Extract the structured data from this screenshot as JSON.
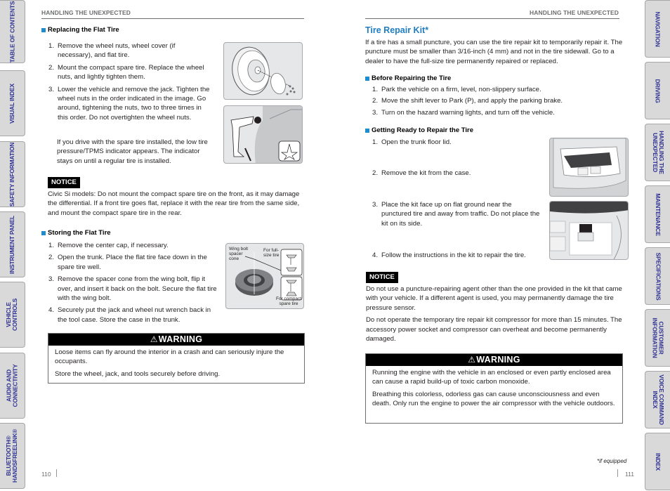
{
  "left_tabs": [
    {
      "label": "TABLE OF CONTENTS"
    },
    {
      "label": "VISUAL INDEX"
    },
    {
      "label": "SAFETY INFORMATION"
    },
    {
      "label": "INSTRUMENT PANEL"
    },
    {
      "label": "VEHICLE\nCONTROLS"
    },
    {
      "label": "AUDIO AND\nCONNECTIVITY"
    },
    {
      "label": "BLUETOOTH®\nHANDSFREELINK®"
    }
  ],
  "right_tabs": [
    {
      "label": "NAVIGATION"
    },
    {
      "label": "DRIVING"
    },
    {
      "label": "HANDLING THE\nUNEXPECTED"
    },
    {
      "label": "MAINTENANCE"
    },
    {
      "label": "SPECIFICATIONS"
    },
    {
      "label": "CUSTOMER\nINFORMATION"
    },
    {
      "label": "VOICE COMMAND\nINDEX"
    },
    {
      "label": "INDEX"
    }
  ],
  "left_page": {
    "running_head": "HANDLING THE UNEXPECTED",
    "page_number": "110",
    "replacing": {
      "heading": "Replacing the Flat Tire",
      "steps": [
        {
          "n": "1.",
          "text": "Remove the wheel nuts, wheel cover (if necessary), and flat tire."
        },
        {
          "n": "2.",
          "text": "Mount the compact spare tire. Replace the wheel nuts, and lightly tighten them."
        },
        {
          "n": "3.",
          "text": "Lower the vehicle and remove the jack. Tighten the wheel nuts in the order indicated in the image. Go around, tightening the nuts, two to three times in this order. Do not overtighten the wheel nuts."
        }
      ],
      "note": "If you drive with the spare tire installed, the low tire pressure/TPMS indicator appears. The indicator stays on until a regular tire is installed."
    },
    "notice": {
      "label": "NOTICE",
      "text": "Civic Si models: Do not mount the compact spare tire on the front, as it may damage the differential. If a front tire goes flat, replace it with the rear tire from the same side, and mount the compact spare tire in the rear."
    },
    "storing": {
      "heading": "Storing the Flat Tire",
      "steps": [
        {
          "n": "1.",
          "text": "Remove the center cap, if necessary."
        },
        {
          "n": "2.",
          "text": "Open the trunk. Place the flat tire face down in the spare tire well."
        },
        {
          "n": "3.",
          "text": "Remove the spacer cone from the wing bolt, flip it over, and insert it back on the bolt. Secure the flat tire with the wing bolt."
        },
        {
          "n": "4.",
          "text": "Securely put the jack and wheel nut wrench back in the tool case. Store the case in the trunk."
        }
      ],
      "figure_labels": {
        "wing_bolt": "Wing bolt spacer cone",
        "full_size": "For full-size tire",
        "compact": "For compact spare tire"
      }
    },
    "warning": {
      "label": "WARNING",
      "icon": "⚠",
      "paragraphs": [
        "Loose items can fly around the interior in a crash and can seriously injure the occupants.",
        "Store the wheel, jack, and tools securely before driving."
      ]
    }
  },
  "right_page": {
    "running_head": "HANDLING THE UNEXPECTED",
    "page_number": "111",
    "title": "Tire Repair Kit*",
    "intro": "If a tire has a small puncture, you can use the tire repair kit to temporarily repair it. The puncture must be smaller than 3/16-inch (4 mm) and not in the tire sidewall. Go to a dealer to have the full-size tire permanently repaired or replaced.",
    "before": {
      "heading": "Before Repairing the Tire",
      "steps": [
        {
          "n": "1.",
          "text": "Park the vehicle on a firm, level, non-slippery surface."
        },
        {
          "n": "2.",
          "text": "Move the shift lever to Park (P), and apply the parking brake."
        },
        {
          "n": "3.",
          "text": "Turn on the hazard warning lights, and turn off the vehicle."
        }
      ]
    },
    "getting_ready": {
      "heading": "Getting Ready to Repair the Tire",
      "steps": [
        {
          "n": "1.",
          "text": "Open the trunk floor lid."
        },
        {
          "n": "2.",
          "text": "Remove the kit from the case."
        },
        {
          "n": "3.",
          "text": "Place the kit face up on flat ground near the punctured tire and away from traffic. Do not place the kit on its side."
        },
        {
          "n": "4.",
          "text": "Follow the instructions in the kit to repair the tire."
        }
      ]
    },
    "notice": {
      "label": "NOTICE",
      "paragraphs": [
        "Do not use a puncture-repairing agent other than the one provided in the kit that came with your vehicle. If a different agent is used, you may permanently damage the tire pressure sensor.",
        "Do not operate the temporary tire repair kit compressor for more than 15 minutes. The accessory power socket and compressor can overheat and become permanently damaged."
      ]
    },
    "warning": {
      "label": "WARNING",
      "icon": "⚠",
      "paragraphs": [
        "Running the engine with the vehicle in an enclosed or even partly enclosed area can cause a rapid build-up of toxic carbon monoxide.",
        "Breathing this colorless, odorless gas can cause unconsciousness and even death. Only run the engine to power the air compressor with the vehicle outdoors."
      ]
    },
    "footnote": "*if equipped"
  }
}
